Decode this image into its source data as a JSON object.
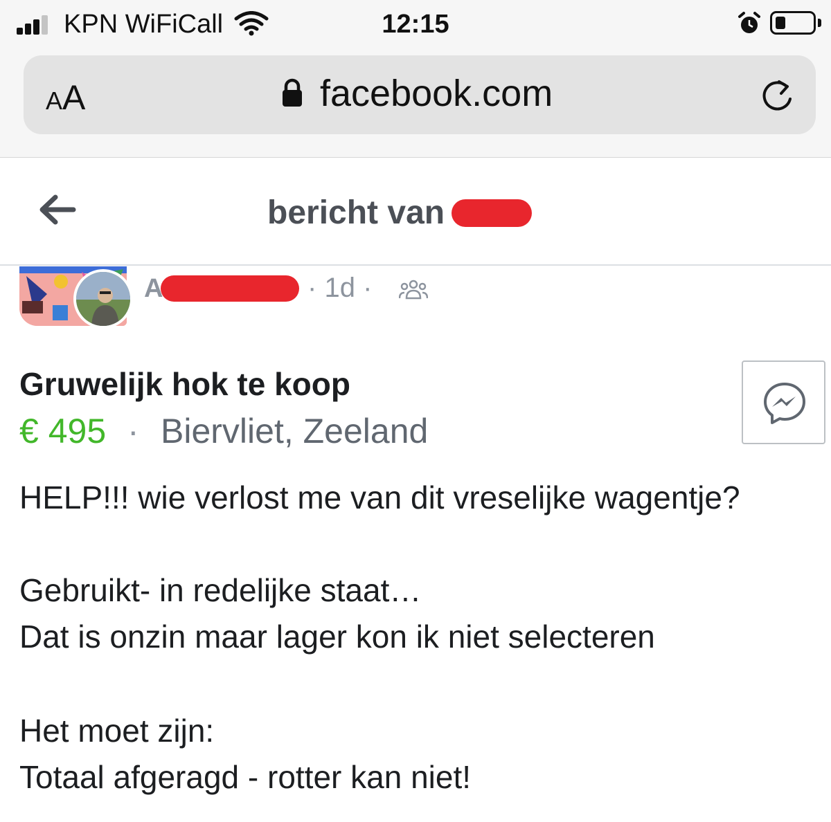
{
  "status_bar": {
    "carrier": "KPN WiFiCall",
    "time": "12:15",
    "icons": [
      "signal-icon",
      "wifi-icon",
      "alarm-icon",
      "battery-icon"
    ]
  },
  "browser": {
    "text_size_small": "A",
    "text_size_big": "A",
    "url": "facebook.com",
    "icons": [
      "lock-icon",
      "reload-icon"
    ]
  },
  "header": {
    "title": "bericht van",
    "icons": [
      "back-arrow-icon"
    ]
  },
  "post": {
    "author_initial": "A",
    "time_ago": "1d",
    "separator": "·",
    "audience_icon": "group-icon",
    "listing_title": "Gruwelijk hok te koop",
    "price": "€ 495",
    "location": "Biervliet, Zeeland",
    "message_icon": "messenger-icon",
    "body": [
      "HELP!!! wie verlost me van dit vreselijke wagentje?",
      "Gebruikt- in redelijke staat…",
      "Dat is onzin maar lager kon ik niet selecteren",
      "Het moet zijn:",
      "Totaal afgeragd - rotter kan niet!"
    ]
  },
  "colors": {
    "price_green": "#42b72a",
    "redaction_red": "#e8262d",
    "meta_gray": "#8d949e"
  }
}
